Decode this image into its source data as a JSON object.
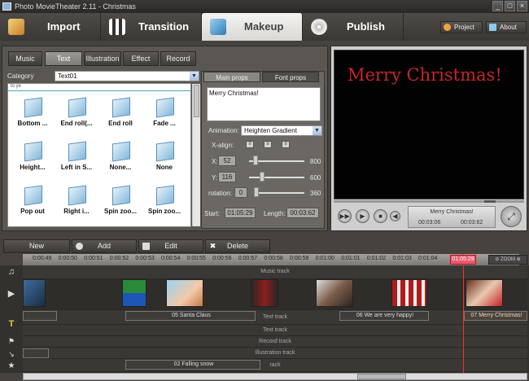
{
  "window": {
    "title": "Photo MovieTheater 2.11 - Christmas",
    "controls": [
      "_",
      "□",
      "×"
    ]
  },
  "main_tabs": [
    {
      "label": "Import",
      "active": false
    },
    {
      "label": "Transition",
      "active": false
    },
    {
      "label": "Makeup",
      "active": true
    },
    {
      "label": "Publish",
      "active": false
    }
  ],
  "header_buttons": {
    "project": "Project",
    "about": "About"
  },
  "sub_tabs": [
    {
      "label": "Music",
      "active": false
    },
    {
      "label": "Text",
      "active": true
    },
    {
      "label": "Illustration",
      "active": false
    },
    {
      "label": "Effect",
      "active": false
    },
    {
      "label": "Record",
      "active": false
    }
  ],
  "category": {
    "label": "Category",
    "value": "Text01"
  },
  "gallery": {
    "header": "to ye",
    "items": [
      "Bottom ...",
      "End roll(...",
      "End roll",
      "Fade ...",
      "Height...",
      "Left in S...",
      "None...",
      "None",
      "Pop out",
      "Right i...",
      "Spin zoo...",
      "Spin zoo..."
    ]
  },
  "props": {
    "tabs": [
      {
        "label": "Main props",
        "active": true
      },
      {
        "label": "Font props",
        "active": false
      }
    ],
    "text": "Merry Christmas!",
    "animation_label": "Animation:",
    "animation_value": "Heighten Gradient",
    "xalign_label": "X-align:",
    "x_label": "X:",
    "x_value": "52",
    "x_max": "800",
    "x_level": 0.07,
    "y_label": "Y:",
    "y_value": "116",
    "y_max": "600",
    "y_level": 0.19,
    "rotation_label": "rotation:",
    "rotation_value": "0",
    "rotation_max": "360",
    "rotation_level": 0.0,
    "start_label": "Start:",
    "start_value": "01:05:29",
    "length_label": "Length:",
    "length_value": "00:03:62"
  },
  "preview": {
    "text": "Merry Christmas!",
    "info_title": "Merry Christmas!",
    "time_current": "00:03:06",
    "time_total": "00:03:62"
  },
  "timeline_toolbar": {
    "new": "New",
    "add": "Add",
    "edit": "Edit",
    "delete": "Delete"
  },
  "ruler": {
    "ticks": [
      "0:00:49",
      "0:00:50",
      "0:00:51",
      "0:00:52",
      "0:00:53",
      "0:00:54",
      "0:00:55",
      "0:00:56",
      "0:00:57",
      "0:00:58",
      "0:00:59",
      "0:01:00",
      "0:01:01",
      "0:01:02",
      "0:01:03",
      "0:01:04"
    ],
    "playhead": "01:05:29",
    "zoom_label": "ZOOM"
  },
  "tracks": {
    "music": "Music track",
    "text": "Text track",
    "text2": "Text track",
    "record": "Record track",
    "illustration": "Illustration track",
    "bottom": "rack"
  },
  "text_clips": [
    "05 Santa Claus",
    "06 We are very happy!",
    "07 Merry Christmas!"
  ],
  "illus_clip": "02 Falling snow",
  "colors": {
    "accent_red": "#c8252a",
    "playhead": "#e33333"
  }
}
